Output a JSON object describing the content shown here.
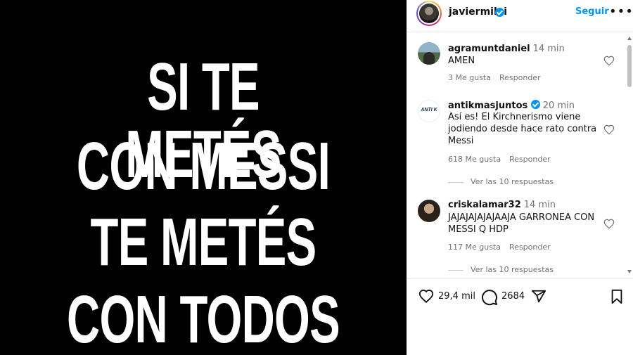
{
  "post": {
    "image_lines": [
      "SI TE METÉS",
      "CON MESSI",
      "TE METÉS",
      "CON TODOS"
    ]
  },
  "header": {
    "username": "javiermilei",
    "follow_label": "Seguir",
    "more_label": "•••"
  },
  "comments": [
    {
      "user": "agramuntdaniel",
      "time": "14 min",
      "text": "AMEN",
      "likes": "3 Me gusta",
      "reply_label": "Responder"
    },
    {
      "user": "antikmasjuntos",
      "time": "20 min",
      "text": "Así es! El Kirchnerismo viene jodiendo desde hace rato contra Messi",
      "likes": "618 Me gusta",
      "reply_label": "Responder",
      "view_replies": "Ver las 10 respuestas",
      "avatar_text": "ANTI K"
    },
    {
      "user": "criskalamar32",
      "time": "14 min",
      "text": "JAJAJAJAJAJAAJA GARRONEA CON MESSI Q HDP",
      "likes": "117 Me gusta",
      "reply_label": "Responder",
      "view_replies": "Ver las 10 respuestas"
    }
  ],
  "actions": {
    "like_count": "29,4 mil",
    "comment_count": "2684"
  },
  "icons": {
    "verified": "verified-badge-icon",
    "heart": "heart-icon",
    "comment": "comment-icon",
    "share": "send-icon",
    "save": "bookmark-icon"
  },
  "colors": {
    "accent": "#0095f6",
    "media_background": "#000000",
    "text": "#111111",
    "muted": "#737373"
  }
}
